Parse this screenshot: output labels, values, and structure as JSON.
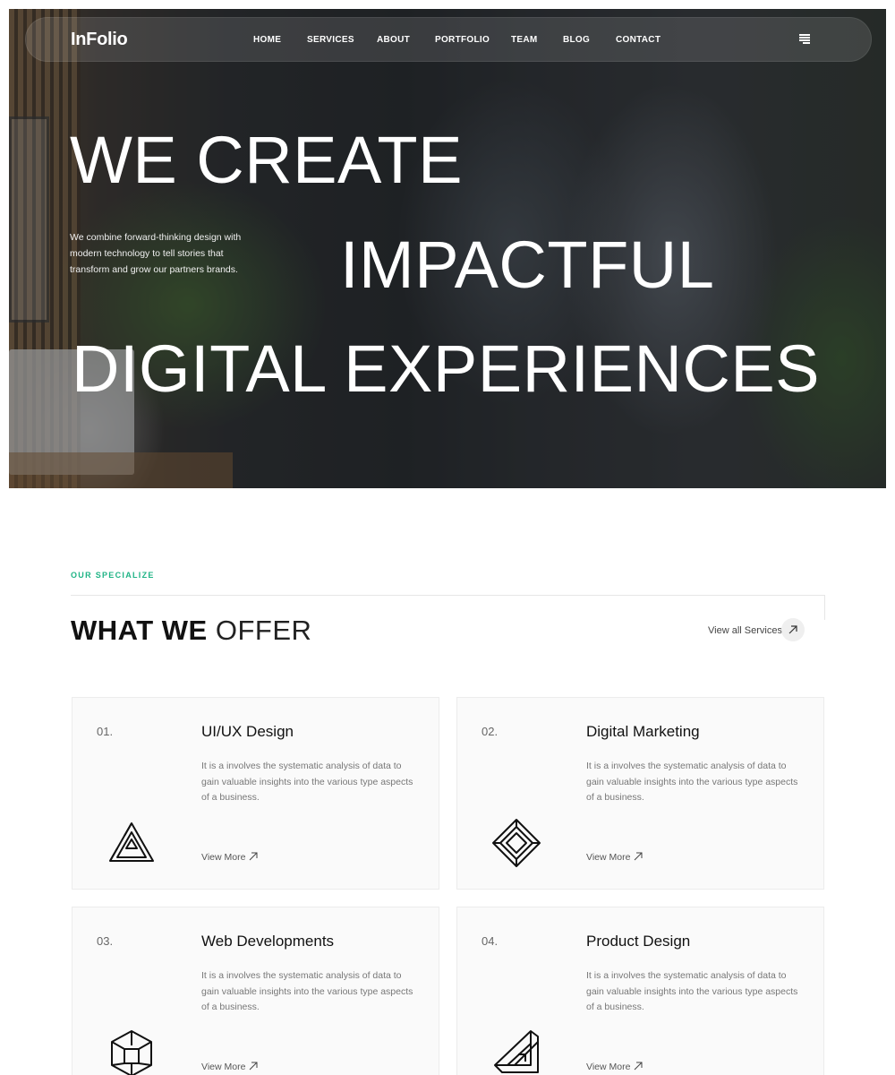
{
  "brand": {
    "name": "InFolio"
  },
  "nav": {
    "items": [
      "HOME",
      "SERVICES",
      "ABOUT",
      "PORTFOLIO",
      "TEAM",
      "BLOG",
      "CONTACT"
    ],
    "menu_icon": "hamburger-icon"
  },
  "hero": {
    "line1": "WE CREATE",
    "line2": "IMPACTFUL",
    "line3": "DIGITAL EXPERIENCES",
    "description": "We combine forward-thinking design with modern technology to tell stories that transform and grow our partners brands."
  },
  "services_section": {
    "eyebrow": "OUR SPECIALIZE",
    "title_bold": "WHAT WE",
    "title_light": "OFFER",
    "view_all": "View all Services",
    "view_all_icon": "arrow-up-right-icon",
    "accent_color": "#20b486",
    "cards": [
      {
        "number": "01.",
        "title": "UI/UX Design",
        "description": "It is a involves the systematic analysis of data to gain valuable insights into the various type aspects of a business.",
        "link": "View More",
        "icon": "impossible-triangle-icon"
      },
      {
        "number": "02.",
        "title": "Digital Marketing",
        "description": "It is a involves the systematic analysis of data to gain valuable insights into the various type aspects of a business.",
        "link": "View More",
        "icon": "impossible-diamond-icon"
      },
      {
        "number": "03.",
        "title": "Web Developments",
        "description": "It is a involves the systematic analysis of data to gain valuable insights into the various type aspects of a business.",
        "link": "View More",
        "icon": "impossible-cube-icon"
      },
      {
        "number": "04.",
        "title": "Product Design",
        "description": "It is a involves the systematic analysis of data to gain valuable insights into the various type aspects of a business.",
        "link": "View More",
        "icon": "impossible-shape-icon"
      }
    ]
  }
}
